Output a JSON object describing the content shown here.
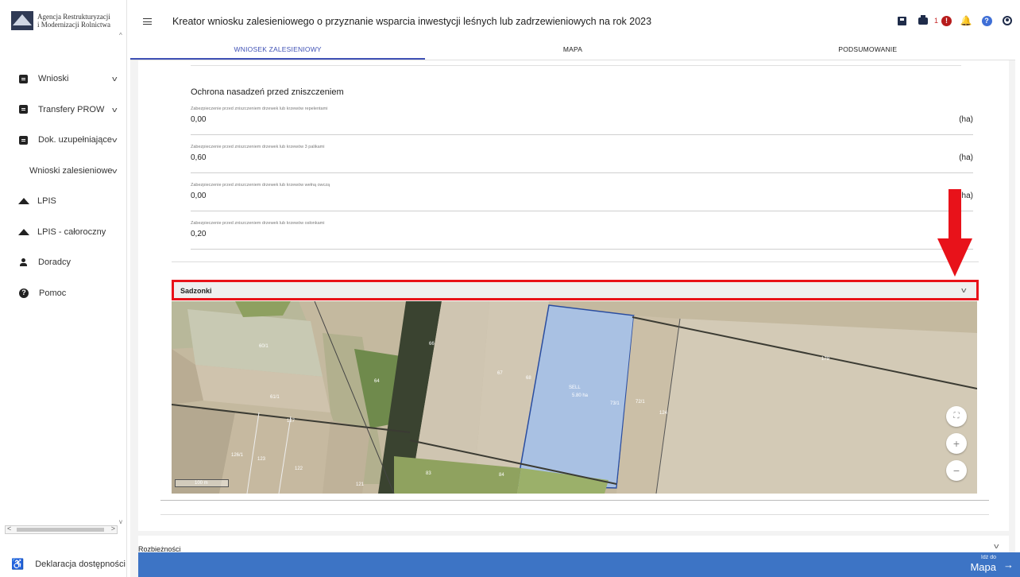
{
  "app": {
    "logo_line1": "Agencja Restrukturyzacji",
    "logo_line2": "i Modernizacji Rolnictwa",
    "title": "Kreator wniosku zalesieniowego o przyznanie wsparcia inwestycji leśnych lub zadrzewieniowych na rok 2023"
  },
  "sidebar": {
    "items": [
      {
        "label": "Wnioski",
        "icon": "document-icon"
      },
      {
        "label": "Transfery PROW",
        "icon": "document-icon"
      },
      {
        "label": "Dok. uzupełniające",
        "icon": "document-icon"
      },
      {
        "label": "Wnioski zalesieniowe",
        "icon": "document-icon"
      },
      {
        "label": "LPIS",
        "icon": "terrain-icon"
      },
      {
        "label": "LPIS - całoroczny",
        "icon": "terrain-icon"
      },
      {
        "label": "Doradcy",
        "icon": "person-icon"
      },
      {
        "label": "Pomoc",
        "icon": "help-icon"
      }
    ],
    "accessibility": "Deklaracja dostępności"
  },
  "toolbar": {
    "notification_count": "1",
    "alert_glyph": "!",
    "help_glyph": "?"
  },
  "tabs": [
    "WNIOSEK ZALESIENIOWY",
    "MAPA",
    "PODSUMOWANIE"
  ],
  "protection": {
    "title": "Ochrona nasadzeń przed zniszczeniem",
    "fields": [
      {
        "label": "Zabezpieczenie przed zniszczeniem drzewek lub krzewów repelentami",
        "value": "0,00",
        "unit": "(ha)"
      },
      {
        "label": "Zabezpieczenie przed zniszczeniem drzewek lub krzewów 3 palikami",
        "value": "0,60",
        "unit": "(ha)"
      },
      {
        "label": "Zabezpieczenie przed zniszczeniem drzewek lub krzewów wełną owczą",
        "value": "0,00",
        "unit": "ha)"
      },
      {
        "label": "Zabezpieczenie przed zniszczeniem drzewek lub krzewów osłonkami",
        "value": "0,20",
        "unit": ""
      }
    ]
  },
  "sadzonki": {
    "label": "Sadzonki"
  },
  "map": {
    "parcel_labels": [
      "60/1",
      "66",
      "64",
      "67",
      "68",
      "61/1",
      "127",
      "126/1",
      "123",
      "122",
      "121",
      "83",
      "84",
      "72/1",
      "73/1",
      "124",
      "179"
    ],
    "selected_parcel_line1": "SELL",
    "selected_parcel_line2": "5.80 ha",
    "scale": "100 m",
    "zoom_in": "+",
    "zoom_out": "−",
    "fullscreen_glyph": "⛶"
  },
  "rozbieznosci": {
    "label": "Rozbieżności"
  },
  "footer": {
    "goto_small": "Idź do",
    "goto_big": "Mapa",
    "arrow": "→"
  },
  "colors": {
    "accent": "#3d74c5",
    "highlight": "#e8121a",
    "tab_active": "#3f51b5"
  }
}
